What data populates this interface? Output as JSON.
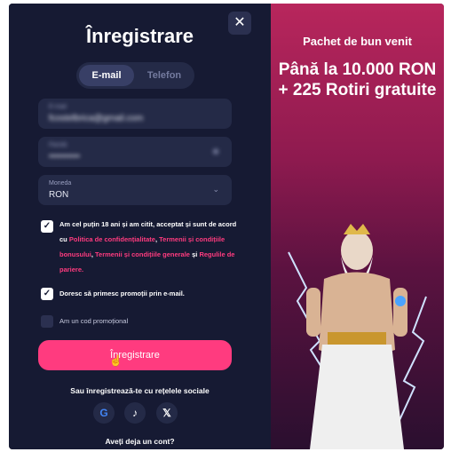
{
  "form": {
    "title": "Înregistrare",
    "close_label": "✕",
    "tabs": [
      {
        "label": "E-mail"
      },
      {
        "label": "Telefon"
      }
    ],
    "fields": {
      "email": {
        "label": "E-mail",
        "value": "fcostelbrica@gmail.com"
      },
      "password": {
        "label": "Parolă",
        "value": "••••••••••"
      },
      "currency": {
        "label": "Moneda",
        "value": "RON"
      }
    },
    "checkboxes": {
      "terms": {
        "text_a": "Am cel puțin 18 ani și am citit, acceptat și sunt de acord cu",
        "link_privacy": "Politica de confidențialitate",
        "link_bonus_terms": "Termenii și condițiile bonusului",
        "link_general_terms": "Termenii și condițiile generale",
        "and_text": "și",
        "link_rules": "Regulile de pariere."
      },
      "promos": {
        "text": "Doresc să primesc promoții prin e-mail."
      },
      "promo_code": {
        "text": "Am un cod promoțional"
      }
    },
    "register_label": "Înregistrare",
    "social_text": "Sau înregistrează-te cu rețelele sociale",
    "social": [
      {
        "glyph": "G"
      },
      {
        "glyph": "♪"
      },
      {
        "glyph": "𝕏"
      }
    ],
    "login_prompt": "Aveți deja un cont?"
  },
  "promo": {
    "header": "Pachet de bun venit",
    "headline": "Până la 10.000 RON + 225 Rotiri gratuite"
  },
  "colors": {
    "accent": "#ff3b7f",
    "panel": "#161a33",
    "field": "#242a47"
  }
}
